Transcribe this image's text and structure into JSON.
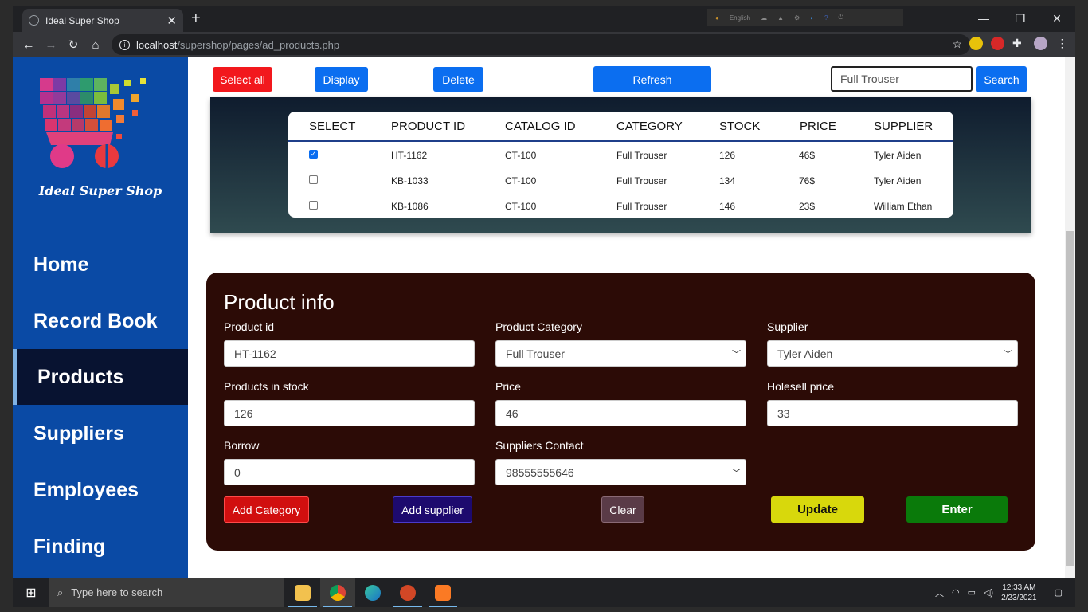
{
  "browser": {
    "tab_title": "Ideal Super Shop",
    "url_host": "localhost",
    "url_path": "/supershop/pages/ad_products.php",
    "lang_label": "English"
  },
  "sidebar": {
    "logo_text": "Ideal Super Shop",
    "items": [
      {
        "label": "Home"
      },
      {
        "label": "Record Book"
      },
      {
        "label": "Products"
      },
      {
        "label": "Suppliers"
      },
      {
        "label": "Employees"
      },
      {
        "label": "Finding"
      }
    ]
  },
  "toolbar": {
    "select_all": "Select all",
    "display": "Display",
    "delete": "Delete",
    "refresh": "Refresh",
    "search_value": "Full Trouser",
    "search": "Search"
  },
  "table": {
    "headers": [
      "SELECT",
      "PRODUCT ID",
      "CATALOG ID",
      "CATEGORY",
      "STOCK",
      "PRICE",
      "SUPPLIER"
    ],
    "rows": [
      {
        "checked": true,
        "product_id": "HT-1162",
        "catalog_id": "CT-100",
        "category": "Full Trouser",
        "stock": "126",
        "price": "46$",
        "supplier": "Tyler Aiden"
      },
      {
        "checked": false,
        "product_id": "KB-1033",
        "catalog_id": "CT-100",
        "category": "Full Trouser",
        "stock": "134",
        "price": "76$",
        "supplier": "Tyler Aiden"
      },
      {
        "checked": false,
        "product_id": "KB-1086",
        "catalog_id": "CT-100",
        "category": "Full Trouser",
        "stock": "146",
        "price": "23$",
        "supplier": "William Ethan"
      }
    ]
  },
  "product_info": {
    "title": "Product info",
    "product_id_label": "Product id",
    "product_id_value": "HT-1162",
    "category_label": "Product Category",
    "category_value": "Full Trouser",
    "supplier_label": "Supplier",
    "supplier_value": "Tyler Aiden",
    "stock_label": "Products in stock",
    "stock_value": "126",
    "price_label": "Price",
    "price_value": "46",
    "holesell_label": "Holesell price",
    "holesell_value": "33",
    "borrow_label": "Borrow",
    "borrow_value": "0",
    "contact_label": "Suppliers Contact",
    "contact_value": "98555555646",
    "buttons": {
      "add_category": "Add Category",
      "add_supplier": "Add supplier",
      "clear": "Clear",
      "update": "Update",
      "enter": "Enter"
    }
  },
  "taskbar": {
    "search_placeholder": "Type here to search",
    "time": "12:33 AM",
    "date": "2/23/2021"
  },
  "colors": {
    "sidebar": "#0a4aa5",
    "primary_button": "#0b6ef0",
    "danger_button": "#f2181d",
    "panel": "#2c0b06"
  }
}
